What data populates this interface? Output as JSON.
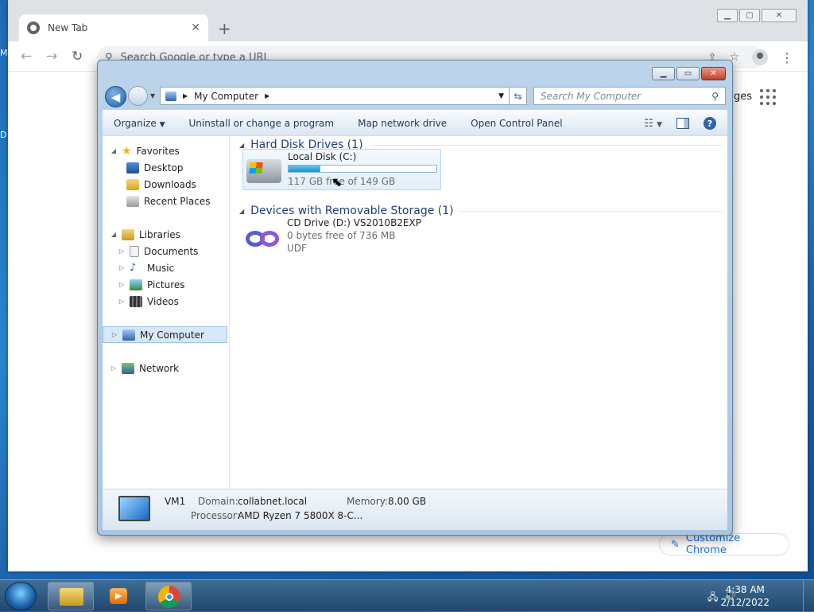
{
  "chrome": {
    "tab_title": "New Tab",
    "omnibox_placeholder": "Search Google or type a URL",
    "images_link": "ges",
    "customize_label": "Customize Chrome"
  },
  "explorer": {
    "address_location": "My Computer",
    "search_placeholder": "Search My Computer",
    "commands": [
      "Organize",
      "Uninstall or change a program",
      "Map network drive",
      "Open Control Panel"
    ],
    "nav": {
      "favorites": "Favorites",
      "desktop": "Desktop",
      "downloads": "Downloads",
      "recent": "Recent Places",
      "libraries": "Libraries",
      "documents": "Documents",
      "music": "Music",
      "pictures": "Pictures",
      "videos": "Videos",
      "computer": "My Computer",
      "network": "Network"
    },
    "groups": {
      "hdd": "Hard Disk Drives (1)",
      "removable": "Devices with Removable Storage (1)"
    },
    "disk": {
      "name": "Local Disk (C:)",
      "free_text": "117 GB free of 149 GB",
      "used_fraction": 0.215
    },
    "cd": {
      "name": "CD Drive (D:) VS2010B2EXP",
      "free_text": "0 bytes free of 736 MB",
      "fs": "UDF"
    },
    "details": {
      "computer_name": "VM1",
      "domain_label": "Domain:",
      "domain_value": "collabnet.local",
      "memory_label": "Memory:",
      "memory_value": "8.00 GB",
      "processor_label": "Processor:",
      "processor_value": "AMD Ryzen 7 5800X 8-C..."
    }
  },
  "taskbar": {
    "time": "4:38 AM",
    "date": "2/12/2022"
  },
  "desktop": {
    "peek_a": "M",
    "peek_b": "D"
  }
}
